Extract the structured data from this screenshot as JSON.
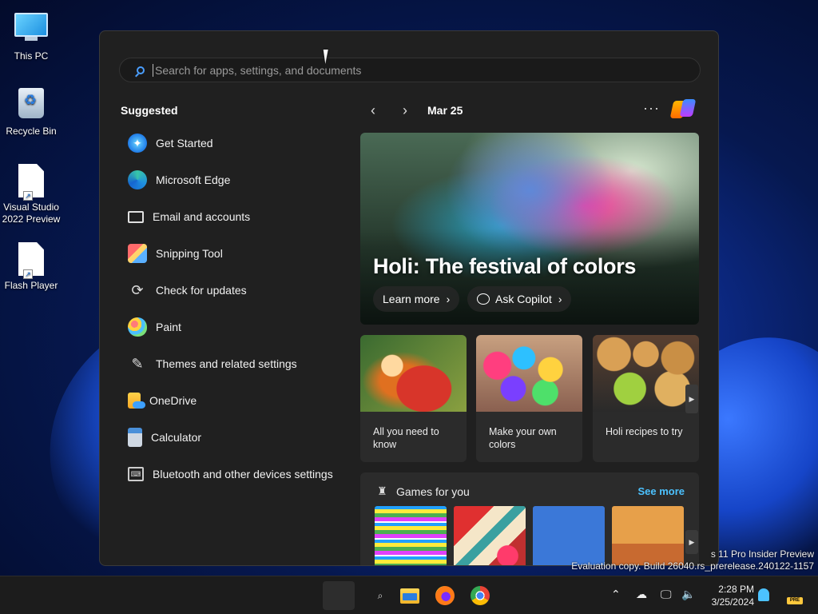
{
  "desktop": {
    "icons": [
      {
        "label": "This PC"
      },
      {
        "label": "Recycle Bin"
      },
      {
        "label": "Visual Studio 2022 Preview"
      },
      {
        "label": "Flash Player"
      }
    ]
  },
  "start_menu": {
    "search_placeholder": "Search for apps, settings, and documents",
    "suggested_title": "Suggested",
    "suggested": [
      {
        "label": "Get Started",
        "icon": "get-started-icon"
      },
      {
        "label": "Microsoft Edge",
        "icon": "edge-icon"
      },
      {
        "label": "Email and accounts",
        "icon": "mail-icon"
      },
      {
        "label": "Snipping Tool",
        "icon": "snipping-tool-icon"
      },
      {
        "label": "Check for updates",
        "icon": "refresh-icon"
      },
      {
        "label": "Paint",
        "icon": "paint-palette-icon"
      },
      {
        "label": "Themes and related settings",
        "icon": "brush-icon"
      },
      {
        "label": "OneDrive",
        "icon": "onedrive-icon"
      },
      {
        "label": "Calculator",
        "icon": "calculator-icon"
      },
      {
        "label": "Bluetooth and other devices settings",
        "icon": "devices-icon"
      }
    ],
    "feed": {
      "date": "Mar 25",
      "more_glyph": "···",
      "hero": {
        "title": "Holi: The festival of colors",
        "learn_more": "Learn more",
        "ask_copilot": "Ask Copilot"
      },
      "cards": [
        {
          "caption": "All you need to know"
        },
        {
          "caption": "Make your own colors"
        },
        {
          "caption": "Holi recipes to try"
        }
      ],
      "games": {
        "title": "Games for you",
        "see_more": "See more"
      }
    }
  },
  "watermark": {
    "line1": "s 11 Pro Insider Preview",
    "line2": "Evaluation copy. Build 26040.rs_prerelease.240122-1157"
  },
  "taskbar": {
    "time": "2:28 PM",
    "date": "3/25/2024",
    "pre_badge": "PRE"
  },
  "colors": {
    "accent": "#4cc2ff",
    "menu_bg": "#202020",
    "card_bg": "#2b2b2b"
  }
}
